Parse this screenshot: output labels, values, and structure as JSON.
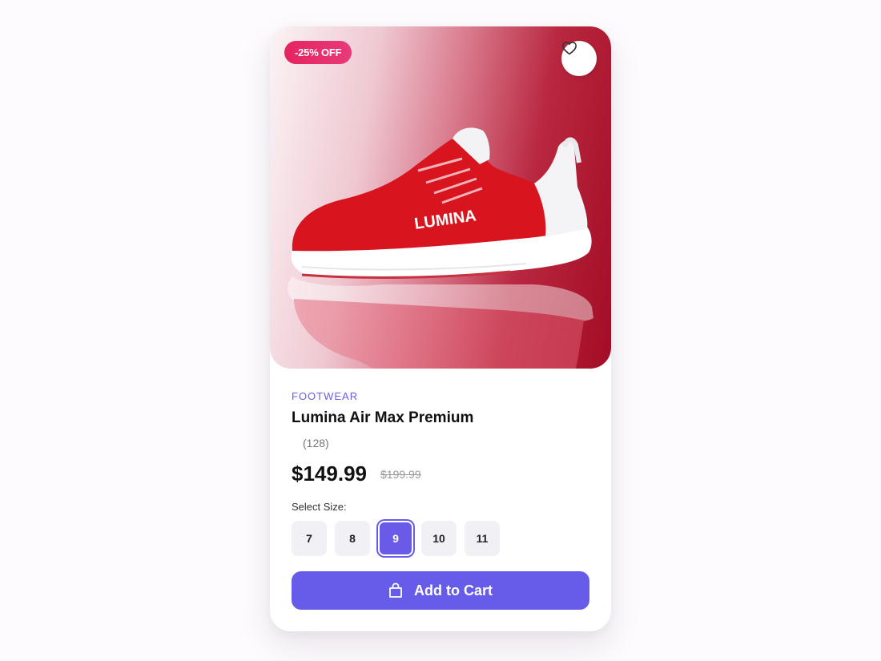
{
  "badge": {
    "discount": "-25% OFF"
  },
  "product": {
    "category": "FOOTWEAR",
    "name": "Lumina Air Max Premium",
    "brand_mark": "LUMINA",
    "reviews": "(128)",
    "price": "$149.99",
    "old_price": "$199.99"
  },
  "sizes": {
    "label": "Select Size:",
    "options": [
      "7",
      "8",
      "9",
      "10",
      "11"
    ],
    "selected": "9"
  },
  "cart": {
    "label": "Add to Cart"
  },
  "icons": {
    "wishlist": "heart-icon",
    "cart": "shopping-bag-icon"
  },
  "colors": {
    "accent": "#675be9",
    "badge": "#e5245f",
    "hero_red": "#a30c24"
  }
}
